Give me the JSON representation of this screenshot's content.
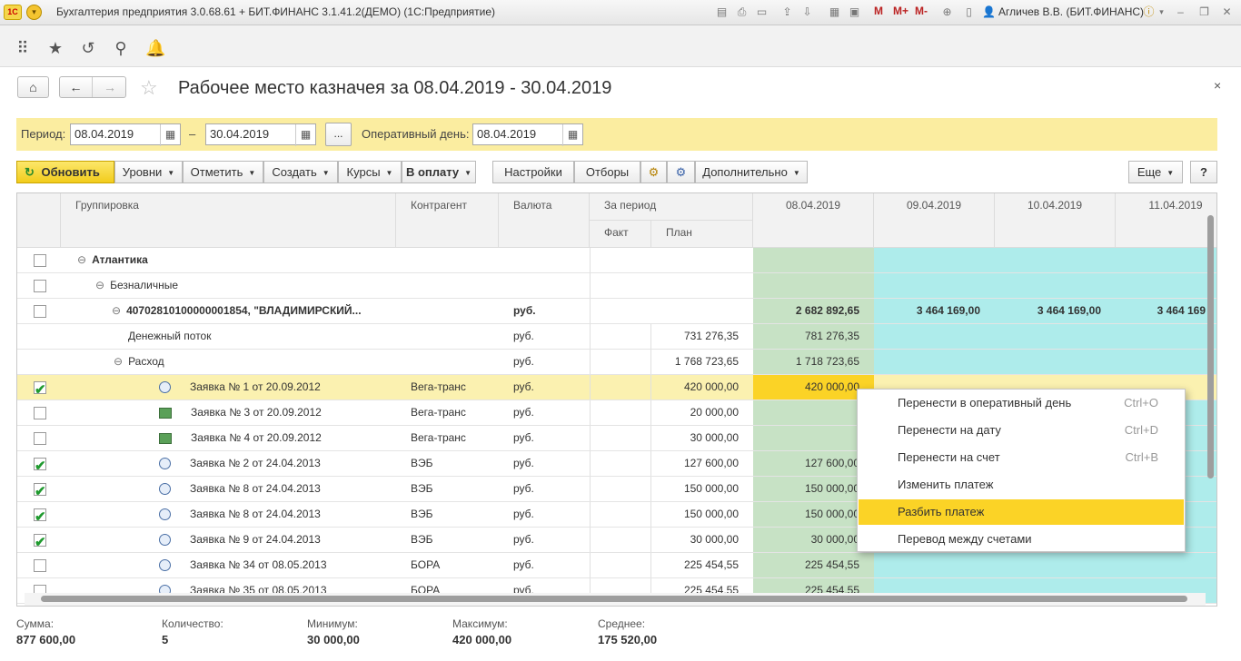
{
  "window": {
    "logo": "1С",
    "title": "Бухгалтерия предприятия 3.0.68.61 + БИТ.ФИНАНС 3.1.41.2(ДЕМО)  (1С:Предприятие)",
    "m_buttons": [
      "M",
      "M+",
      "M-"
    ],
    "user": "Агличев В.В. (БИТ.ФИНАНС)",
    "controls": [
      "–",
      "❐",
      "✕"
    ]
  },
  "form": {
    "title": "Рабочее место казначея за 08.04.2019 - 30.04.2019",
    "close": "×"
  },
  "filter": {
    "period_label": "Период:",
    "date_from": "08.04.2019",
    "dash": "–",
    "date_to": "30.04.2019",
    "more_btn": "...",
    "op_day_label": "Оперативный день:",
    "op_day": "08.04.2019"
  },
  "toolbar": {
    "refresh": "Обновить",
    "levels": "Уровни",
    "mark": "Отметить",
    "create": "Создать",
    "rates": "Курсы",
    "to_pay": "В оплату",
    "settings": "Настройки",
    "filters": "Отборы",
    "extra": "Дополнительно",
    "more": "Еще",
    "help": "?"
  },
  "columns": {
    "grouping": "Группировка",
    "counterparty": "Контрагент",
    "currency": "Валюта",
    "period": "За период",
    "fact": "Факт",
    "plan": "План",
    "dates": [
      "08.04.2019",
      "09.04.2019",
      "10.04.2019",
      "11.04.2019"
    ]
  },
  "rows": [
    {
      "check": false,
      "label": "Атлантика",
      "bold": true,
      "tree": "⊖",
      "contr": "",
      "cur": "",
      "plan": "",
      "d1": "",
      "d2": "",
      "d3": "",
      "d4": ""
    },
    {
      "check": false,
      "label": "Безналичные",
      "bold": false,
      "tree": "⊖",
      "contr": "",
      "cur": "",
      "plan": "",
      "d1": "",
      "d2": "",
      "d3": "",
      "d4": ""
    },
    {
      "check": false,
      "label": "40702810100000001854, \"ВЛАДИМИРСКИЙ...",
      "bold": true,
      "tree": "⊖",
      "contr": "",
      "cur": "руб.",
      "plan": "",
      "d1": "2 682 892,65",
      "d2": "3 464 169,00",
      "d3": "3 464 169,00",
      "d4": "3 464 169"
    },
    {
      "check": null,
      "label": "Денежный поток",
      "bold": false,
      "tree": "",
      "contr": "",
      "cur": "руб.",
      "plan": "731 276,35",
      "d1": "781 276,35",
      "d2": "",
      "d3": "",
      "d4": ""
    },
    {
      "check": null,
      "label": "Расход",
      "bold": false,
      "tree": "⊖",
      "contr": "",
      "cur": "руб.",
      "plan": "1 768 723,65",
      "d1": "1 718 723,65",
      "d2": "",
      "d3": "",
      "d4": ""
    },
    {
      "check": true,
      "label": "Заявка № 1 от 20.09.2012",
      "bold": false,
      "icon": "clock",
      "contr": "Вега-транс",
      "cur": "руб.",
      "plan": "420 000,00",
      "d1": "420 000,00",
      "d2": "",
      "d3": "",
      "d4": ""
    },
    {
      "check": false,
      "label": "Заявка № 3 от 20.09.2012",
      "bold": false,
      "icon": "doc",
      "contr": "Вега-транс",
      "cur": "руб.",
      "plan": "20 000,00",
      "d1": "",
      "d2": "",
      "d3": "",
      "d4": ""
    },
    {
      "check": false,
      "label": "Заявка № 4 от 20.09.2012",
      "bold": false,
      "icon": "doc",
      "contr": "Вега-транс",
      "cur": "руб.",
      "plan": "30 000,00",
      "d1": "",
      "d2": "",
      "d3": "",
      "d4": ""
    },
    {
      "check": true,
      "label": "Заявка № 2 от 24.04.2013",
      "bold": false,
      "icon": "clock",
      "contr": "ВЭБ",
      "cur": "руб.",
      "plan": "127 600,00",
      "d1": "127 600,00",
      "d2": "",
      "d3": "",
      "d4": ""
    },
    {
      "check": true,
      "label": "Заявка № 8 от 24.04.2013",
      "bold": false,
      "icon": "clock",
      "contr": "ВЭБ",
      "cur": "руб.",
      "plan": "150 000,00",
      "d1": "150 000,00",
      "d2": "",
      "d3": "",
      "d4": ""
    },
    {
      "check": true,
      "label": "Заявка № 8 от 24.04.2013",
      "bold": false,
      "icon": "clock",
      "contr": "ВЭБ",
      "cur": "руб.",
      "plan": "150 000,00",
      "d1": "150 000,00",
      "d2": "",
      "d3": "",
      "d4": ""
    },
    {
      "check": true,
      "label": "Заявка № 9 от 24.04.2013",
      "bold": false,
      "icon": "clock",
      "contr": "ВЭБ",
      "cur": "руб.",
      "plan": "30 000,00",
      "d1": "30 000,00",
      "d2": "",
      "d3": "",
      "d4": ""
    },
    {
      "check": false,
      "label": "Заявка № 34 от 08.05.2013",
      "bold": false,
      "icon": "clock",
      "contr": "БОРА",
      "cur": "руб.",
      "plan": "225 454,55",
      "d1": "225 454,55",
      "d2": "",
      "d3": "",
      "d4": ""
    },
    {
      "check": false,
      "label": "Заявка № 35 от 08.05.2013",
      "bold": false,
      "icon": "clock",
      "contr": "БОРА",
      "cur": "руб.",
      "plan": "225 454,55",
      "d1": "225 454,55",
      "d2": "",
      "d3": "",
      "d4": ""
    }
  ],
  "context_menu": [
    {
      "label": "Перенести в оперативный день",
      "key": "Ctrl+O"
    },
    {
      "label": "Перенести на дату",
      "key": "Ctrl+D"
    },
    {
      "label": "Перенести на счет",
      "key": "Ctrl+B"
    },
    {
      "label": "Изменить платеж",
      "key": ""
    },
    {
      "label": "Разбить платеж",
      "key": ""
    },
    {
      "label": "Перевод между счетами",
      "key": ""
    }
  ],
  "footer": {
    "sum_label": "Сумма:",
    "sum": "877 600,00",
    "count_label": "Количество:",
    "count": "5",
    "min_label": "Минимум:",
    "min": "30 000,00",
    "max_label": "Максимум:",
    "max": "420 000,00",
    "avg_label": "Среднее:",
    "avg": "175 520,00"
  },
  "colors": {
    "selected_row": "#fbf1b0",
    "selected_cell": "#fbd326",
    "green": "#c7e2c5",
    "cyan": "#aeeceb",
    "accent": "#f5c518"
  }
}
